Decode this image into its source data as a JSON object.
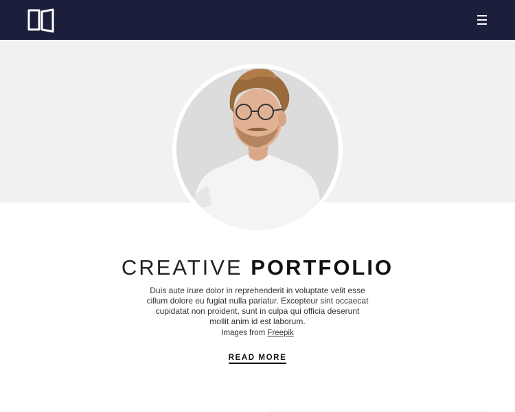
{
  "header": {
    "logo_icon": "open-book-icon",
    "menu_icon": "hamburger-menu-icon",
    "background": "#1b1f3b"
  },
  "hero": {
    "background": "#f1f1f1",
    "photo": "man-portrait"
  },
  "main": {
    "title_light": "CREATIVE",
    "title_bold": "PORTFOLIO",
    "description": "Duis aute irure dolor in reprehenderit in voluptate velit esse cillum dolore eu fugiat nulla pariatur. Excepteur sint occaecat cupidatat non proident, sunt in culpa qui officia deserunt mollit anim id est laborum.",
    "credit_prefix": "Images from",
    "credit_link": "Freepik",
    "read_more": "READ MORE"
  }
}
